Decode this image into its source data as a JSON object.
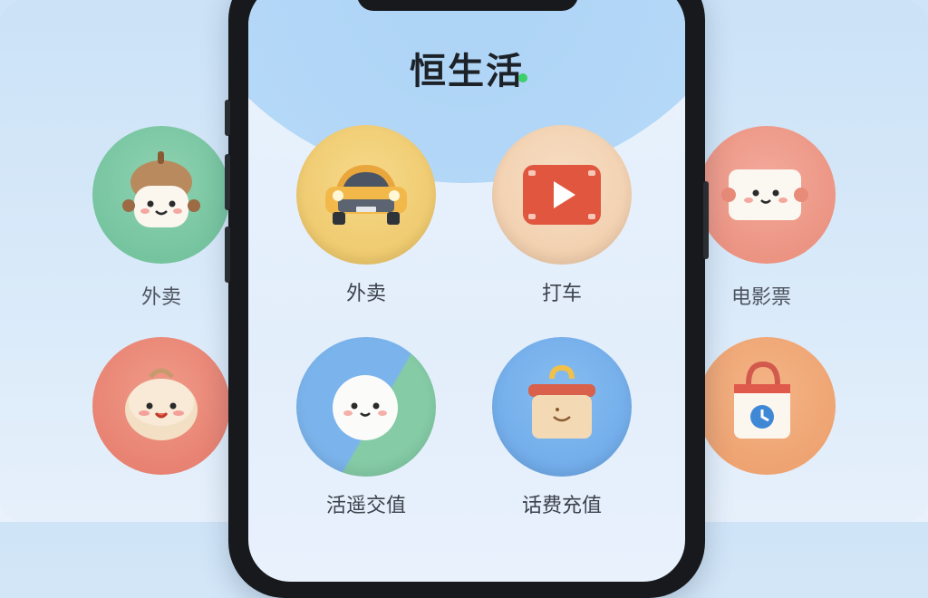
{
  "phone": {
    "app_title": "恒生活",
    "tiles": [
      {
        "label": "外卖",
        "icon": "car-icon"
      },
      {
        "label": "打车",
        "icon": "video-play-icon"
      },
      {
        "label": "活遥交值",
        "icon": "mascot-icon"
      },
      {
        "label": "话费充值",
        "icon": "bag-icon"
      }
    ]
  },
  "side_left": [
    {
      "label": "外卖",
      "icon": "acorn-mascot-icon"
    },
    {
      "icon": "dumpling-mascot-icon"
    }
  ],
  "side_right": [
    {
      "label": "电影票",
      "icon": "ticket-icon"
    },
    {
      "icon": "shopping-bag-clock-icon"
    }
  ],
  "colors": {
    "green": "#79c7a2",
    "yellow": "#f0cd74",
    "peach": "#f3d4b6",
    "coral": "#ec8873",
    "blue": "#7eb3ea",
    "salmon": "#ee9d8c",
    "orange": "#f1a776"
  }
}
